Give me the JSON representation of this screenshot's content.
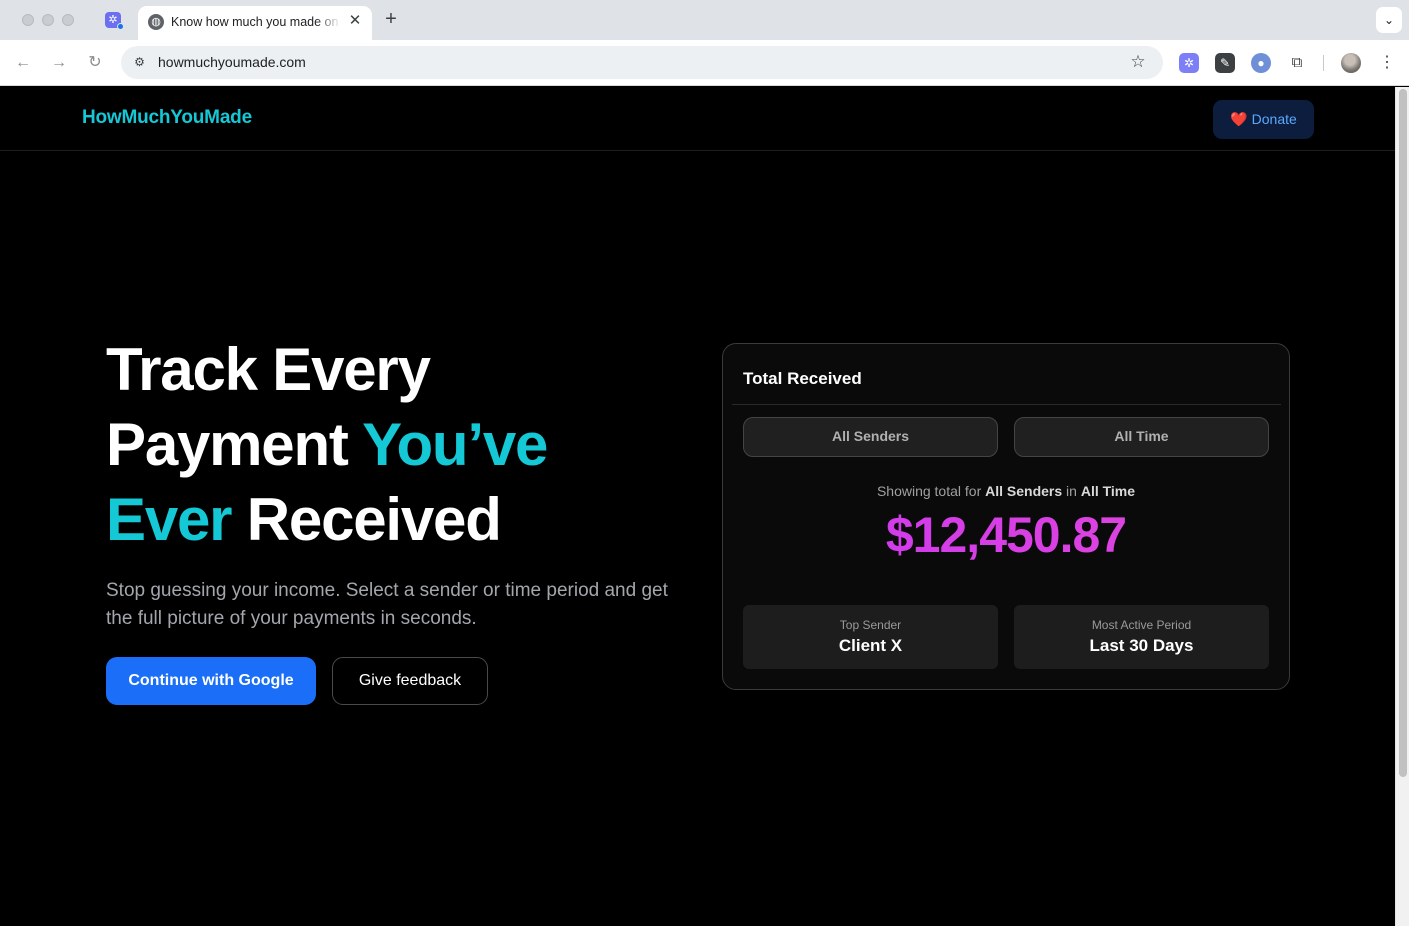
{
  "browser": {
    "tab_title": "Know how much you made on",
    "url": "howmuchyoumade.com",
    "icons": {
      "pinned_tab": "extension-app-icon",
      "tab_favicon": "globe-icon",
      "tab_close": "close-icon",
      "new_tab": "plus-icon",
      "tab_menu": "chevron-down-icon",
      "back": "arrow-left-icon",
      "forward": "arrow-right-icon",
      "reload": "reload-icon",
      "site_info": "tune-icon",
      "bookmark": "star-icon",
      "extensions": "puzzle-icon",
      "menu": "kebab-icon"
    },
    "glyphs": {
      "close": "✕",
      "plus": "+",
      "chevron": "⌄",
      "back": "←",
      "forward": "→",
      "reload": "↻",
      "tune": "⚙",
      "star": "☆",
      "kebab": "⋮",
      "ext1": "✲",
      "ext2": "✎",
      "ext3": "●",
      "ext4": "⧉",
      "globe": "◍"
    }
  },
  "site": {
    "logo": "HowMuchYouMade",
    "donate_heart": "❤️",
    "donate_label": "Donate"
  },
  "hero": {
    "title_line1": "Track Every",
    "title_line2_a": "Payment ",
    "title_line2_b": "You’ve",
    "title_line3_a": "Ever",
    "title_line3_b": " Received",
    "subtitle": "Stop guessing your income. Select a sender or time period and get the full picture of your payments in seconds.",
    "primary_button": "Continue with Google",
    "secondary_button": "Give feedback"
  },
  "card": {
    "title": "Total Received",
    "sender_filter": "All Senders",
    "period_filter": "All Time",
    "showing_prefix": "Showing total for ",
    "showing_sender": "All Senders",
    "showing_mid": " in ",
    "showing_period": "All Time",
    "amount": "$12,450.87",
    "stats": [
      {
        "label": "Top Sender",
        "value": "Client X"
      },
      {
        "label": "Most Active Period",
        "value": "Last 30 Days"
      }
    ]
  },
  "colors": {
    "accent": "#14c8d6",
    "primary_button": "#1a6ef7",
    "amount": "#d43ef0",
    "background": "#000000"
  }
}
